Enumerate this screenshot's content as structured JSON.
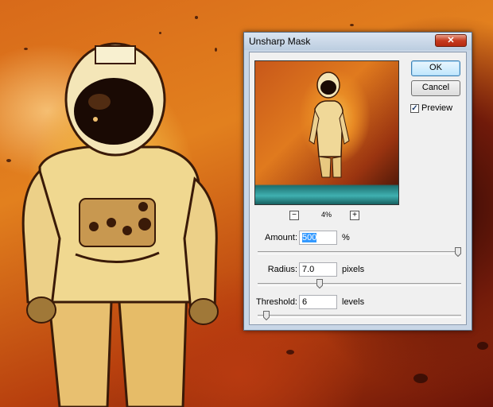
{
  "dialog": {
    "title": "Unsharp Mask",
    "close_symbol": "✕",
    "ok_label": "OK",
    "cancel_label": "Cancel",
    "preview_label": "Preview",
    "preview_checked": true,
    "zoom_out_symbol": "−",
    "zoom_in_symbol": "+",
    "zoom_level": "4%",
    "amount": {
      "label": "Amount:",
      "value": "500",
      "unit": "%",
      "slider_fraction": 1.0
    },
    "radius": {
      "label": "Radius:",
      "value": "7.0",
      "unit": "pixels",
      "slider_fraction": 0.3
    },
    "threshold": {
      "label": "Threshold:",
      "value": "6",
      "unit": "levels",
      "slider_fraction": 0.03
    }
  },
  "colors": {
    "accent": "#3399ff",
    "close": "#c63b1f"
  },
  "icons": [
    "close-icon",
    "checkbox-check-icon",
    "zoom-out-icon",
    "zoom-in-icon",
    "slider-thumb-icon"
  ]
}
